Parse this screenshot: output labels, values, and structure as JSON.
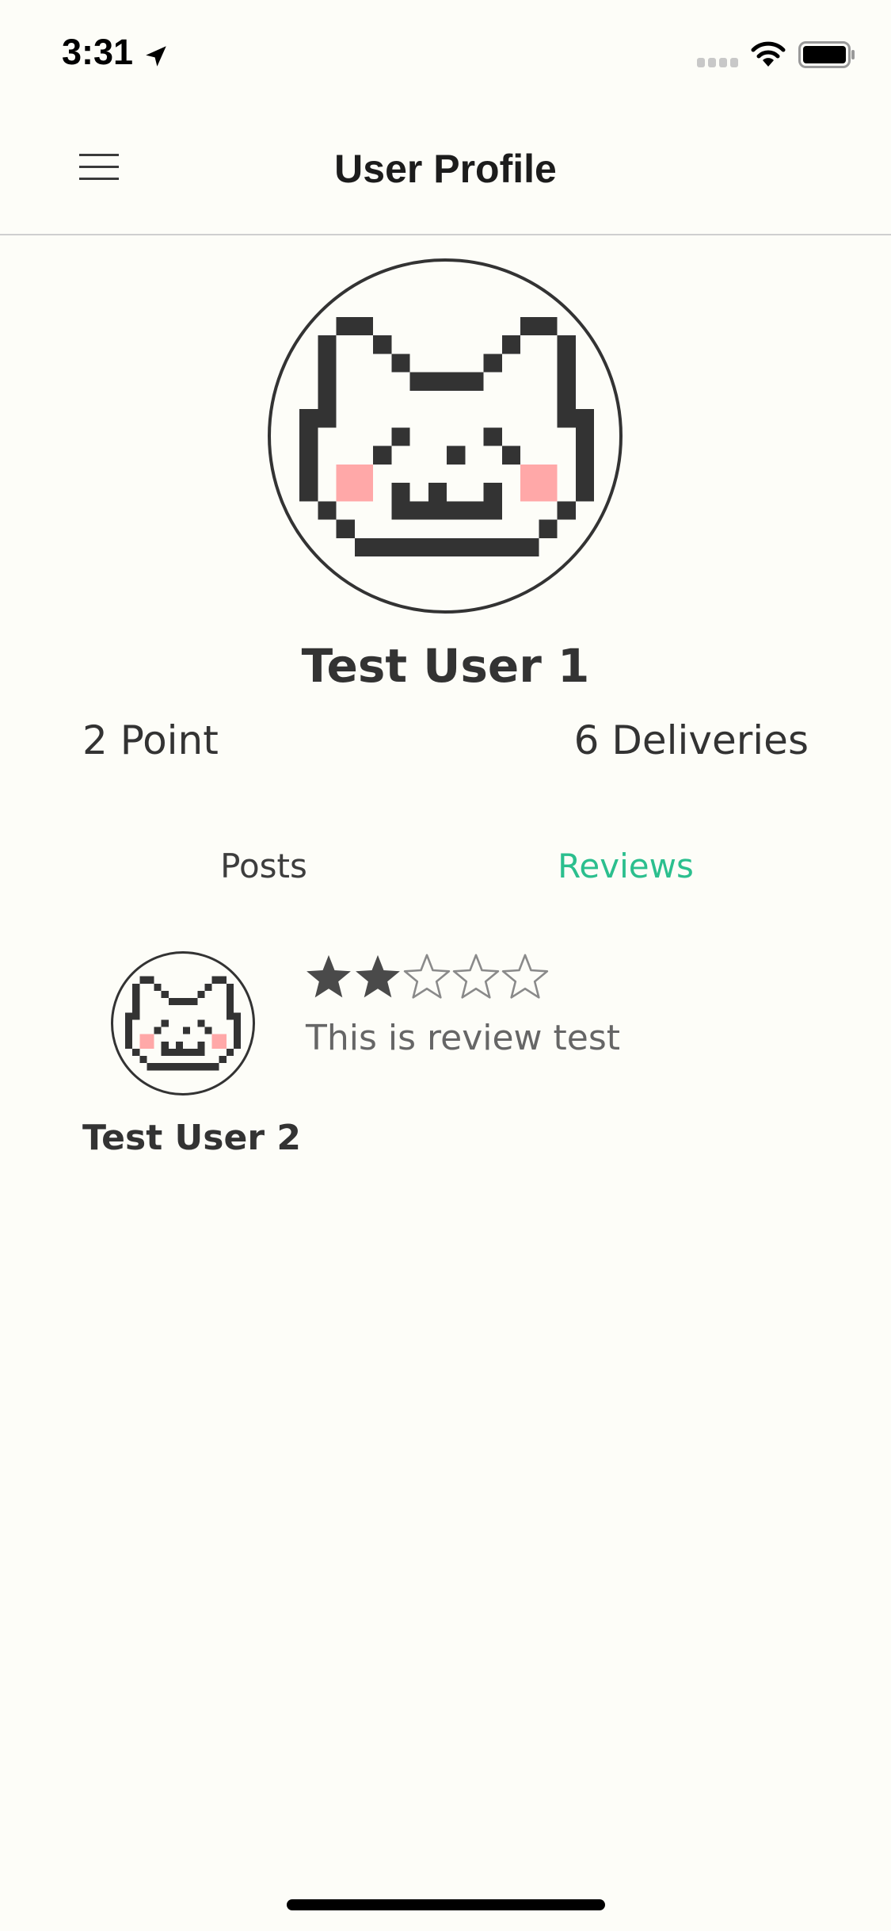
{
  "status_bar": {
    "time": "3:31",
    "icons": [
      "location-arrow-icon",
      "signal-icon",
      "wifi-icon",
      "battery-icon"
    ]
  },
  "nav": {
    "title": "User Profile",
    "menu_icon": "hamburger-menu-icon"
  },
  "profile": {
    "name": "Test User 1",
    "points": "2 Point",
    "deliveries": "6 Deliveries",
    "avatar_icon": "pixel-cat-avatar"
  },
  "tabs": [
    {
      "label": "Posts",
      "active": false
    },
    {
      "label": "Reviews",
      "active": true
    }
  ],
  "reviews": [
    {
      "reviewer": "Test User 2",
      "rating": 2,
      "max_rating": 5,
      "text": "This is review test"
    }
  ],
  "colors": {
    "background": "#fdfdf8",
    "accent": "#2bbf8e",
    "text": "#333333",
    "blush": "#ffa8a8"
  }
}
